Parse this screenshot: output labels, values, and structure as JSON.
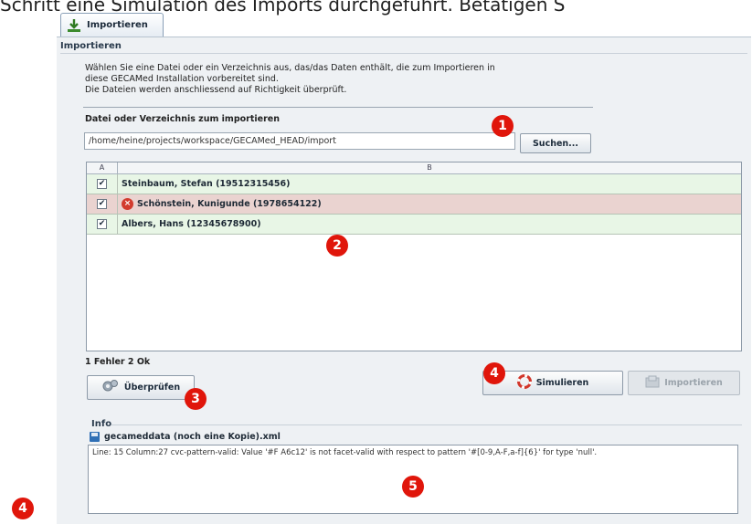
{
  "caption": "Schritt eine Simulation des Imports durchgeführt. Betätigen S",
  "tab": {
    "label": "Importieren",
    "icon": "import-download-icon"
  },
  "import_group": {
    "title": "Importieren",
    "description": [
      "Wählen Sie eine Datei oder ein Verzeichnis aus, das/das Daten enthält, die zum Importieren in",
      "diese GECAMed Installation vorbereitet sind.",
      "Die Dateien werden anschliessend auf Richtigkeit überprüft."
    ],
    "path_label": "Datei oder Verzeichnis zum importieren",
    "path_value": "/home/heine/projects/workspace/GECAMed_HEAD/import",
    "search_button": "Suchen..."
  },
  "table": {
    "columns": [
      "A",
      "B"
    ],
    "rows": [
      {
        "checked": true,
        "status": "ok",
        "name": "Steinbaum, Stefan (19512315456)"
      },
      {
        "checked": true,
        "status": "error",
        "name": "Schönstein, Kunigunde (1978654122)"
      },
      {
        "checked": true,
        "status": "ok",
        "name": "Albers, Hans (12345678900)"
      }
    ]
  },
  "status_text": "1 Fehler  2 Ok",
  "buttons": {
    "check": "Überprüfen",
    "simulate": "Simulieren",
    "import": "Importieren"
  },
  "info": {
    "title": "Info",
    "file": "gecameddata (noch eine Kopie).xml",
    "message": "Line: 15 Column:27  cvc-pattern-valid: Value '#F A6c12' is not facet-valid with respect to pattern '#[0-9,A-F,a-f]{6}' for type 'null'."
  },
  "badges": [
    "1",
    "2",
    "3",
    "4",
    "5",
    "4"
  ],
  "colors": {
    "badge": "#e0160b",
    "row_ok": "#e8f6e6",
    "row_error": "#ead3d0"
  }
}
